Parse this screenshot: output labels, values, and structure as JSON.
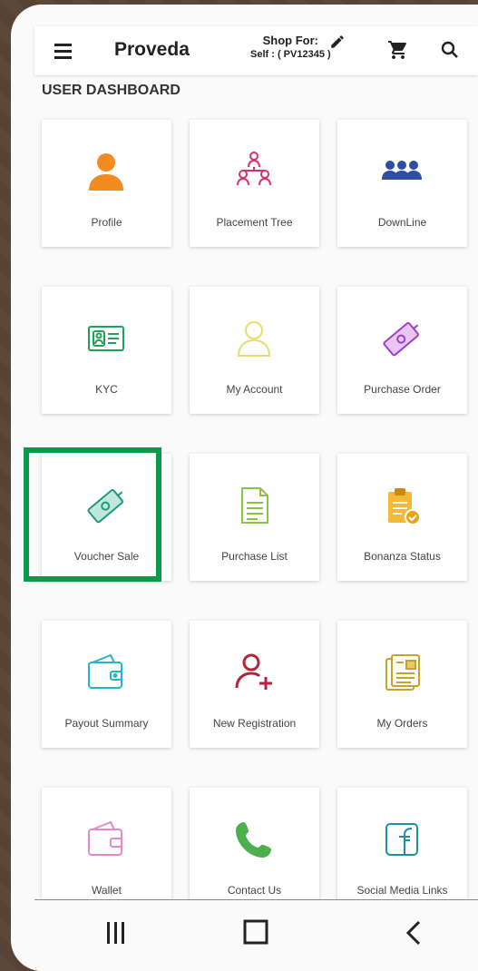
{
  "header": {
    "brand": "Proveda",
    "shop_for_label": "Shop For:",
    "shop_for_value": "Self : ( PV12345 )"
  },
  "dashboard": {
    "title": "USER DASHBOARD",
    "tiles": [
      {
        "label": "Profile",
        "icon": "profile-icon",
        "color": "#f28c1e"
      },
      {
        "label": "Placement Tree",
        "icon": "placement-tree-icon",
        "color": "#d6336c"
      },
      {
        "label": "DownLine",
        "icon": "downline-icon",
        "color": "#2c4fa3"
      },
      {
        "label": "KYC",
        "icon": "kyc-icon",
        "color": "#1ea35a"
      },
      {
        "label": "My Account",
        "icon": "my-account-icon",
        "color": "#e8dc6a"
      },
      {
        "label": "Purchase Order",
        "icon": "purchase-order-icon",
        "color": "#a23dc9"
      },
      {
        "label": "Voucher Sale",
        "icon": "voucher-sale-icon",
        "color": "#1f9a7a"
      },
      {
        "label": "Purchase List",
        "icon": "purchase-list-icon",
        "color": "#8bc34a"
      },
      {
        "label": "Bonanza Status",
        "icon": "bonanza-status-icon",
        "color": "#e8a317"
      },
      {
        "label": "Payout Summary",
        "icon": "payout-summary-icon",
        "color": "#1fb6c9"
      },
      {
        "label": "New Registration",
        "icon": "new-registration-icon",
        "color": "#b3243a"
      },
      {
        "label": "My Orders",
        "icon": "my-orders-icon",
        "color": "#c9a227"
      },
      {
        "label": "Wallet",
        "icon": "wallet-icon",
        "color": "#e58ac9"
      },
      {
        "label": "Contact Us",
        "icon": "phone-icon",
        "color": "#4caf50"
      },
      {
        "label": "Social Media Links",
        "icon": "facebook-icon",
        "color": "#1e8fa3"
      }
    ]
  },
  "highlight_color": "#0b9a4a"
}
